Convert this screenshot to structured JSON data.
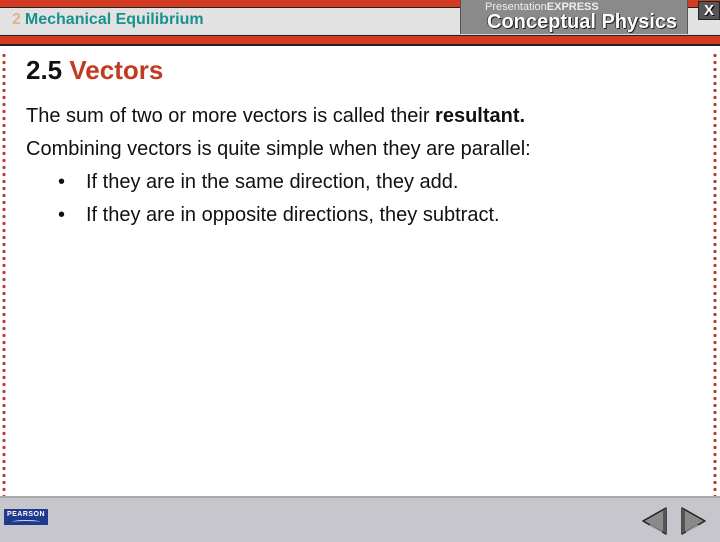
{
  "header": {
    "chapter_number": "2",
    "chapter_title": "Mechanical Equilibrium",
    "brand_prefix_light": "Presentation",
    "brand_prefix_bold": "EXPRESS",
    "brand_title": "Conceptual Physics",
    "close_label": "X"
  },
  "slide": {
    "section_number": "2.5",
    "section_title": "Vectors",
    "lines": [
      {
        "text": "The sum of two or more vectors is called their ",
        "bold": "resultant."
      },
      {
        "text": "Combining vectors is quite simple when they are parallel:"
      }
    ],
    "bullets": [
      "If they are in the same direction, they add.",
      "If they are in opposite directions, they subtract."
    ],
    "bullet_glyph": "•"
  },
  "footer": {
    "publisher_logo": "PEARSON",
    "prev_icon": "previous-arrow-icon",
    "next_icon": "next-arrow-icon"
  },
  "colors": {
    "accent_red": "#d23a22",
    "title_red": "#c23a22",
    "chapter_teal": "#17928f",
    "chapter_number_tan": "#e0b48a",
    "pearson_blue": "#1f3a8c"
  }
}
